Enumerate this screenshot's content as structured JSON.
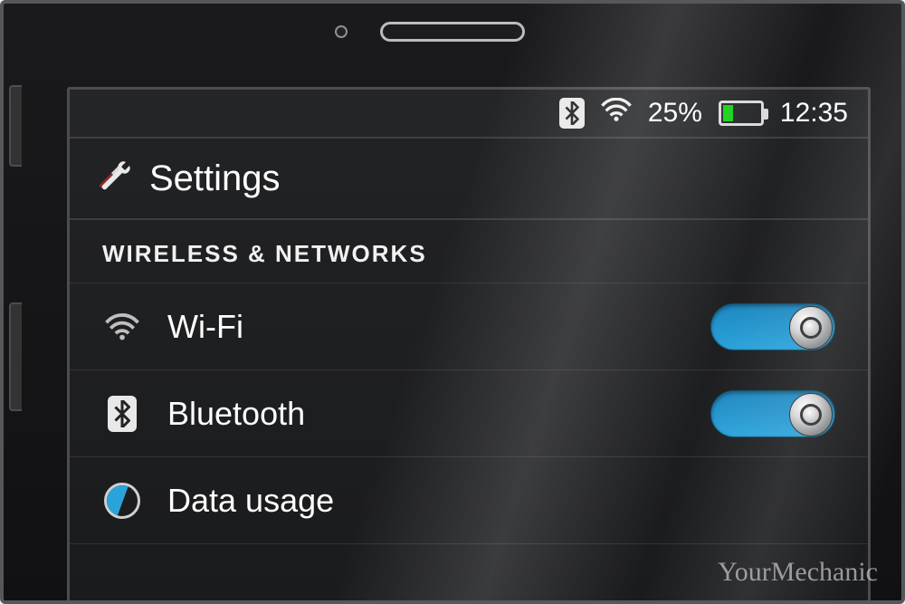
{
  "statusbar": {
    "battery_percent": "25%",
    "clock": "12:35"
  },
  "header": {
    "title": "Settings"
  },
  "section": {
    "label": "WIRELESS & NETWORKS"
  },
  "rows": {
    "wifi": {
      "label": "Wi-Fi",
      "toggle": true
    },
    "bluetooth": {
      "label": "Bluetooth",
      "toggle": true
    },
    "data": {
      "label": "Data usage"
    }
  },
  "watermark": "YourMechanic"
}
